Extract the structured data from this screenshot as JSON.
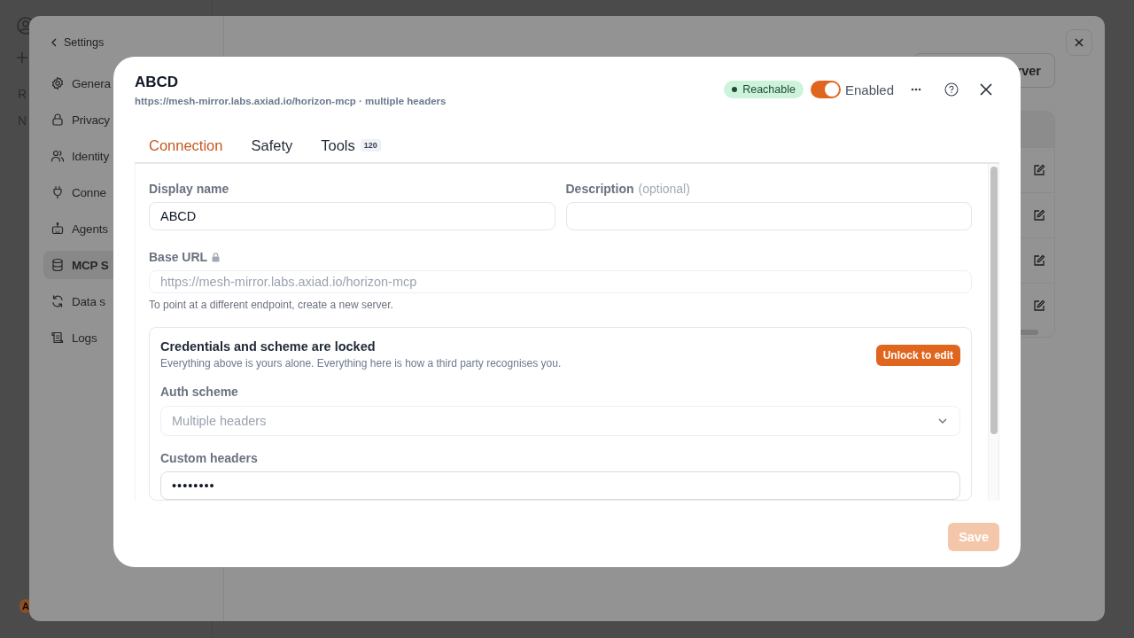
{
  "app": {
    "rail_items": [
      {
        "label": "R"
      },
      {
        "label": "N"
      }
    ],
    "avatar": "A"
  },
  "settings": {
    "back": "Settings",
    "nav": [
      {
        "label": "Genera",
        "selected": false
      },
      {
        "label": "Privacy",
        "selected": false
      },
      {
        "label": "Identity",
        "selected": false
      },
      {
        "label": "Conne",
        "selected": false
      },
      {
        "label": "Agents",
        "selected": false
      },
      {
        "label": "MCP S",
        "selected": true
      },
      {
        "label": "Data s",
        "selected": false
      },
      {
        "label": "Logs",
        "selected": false
      }
    ],
    "add_button": "rver",
    "rows": [
      {
        "kind": "editable"
      },
      {
        "kind": "editable"
      },
      {
        "kind": "editable"
      },
      {
        "kind": "editable"
      }
    ]
  },
  "dialog": {
    "title": "ABCD",
    "subtitle": "https://mesh-mirror.labs.axiad.io/horizon-mcp · multiple headers",
    "status": {
      "label": "Reachable"
    },
    "enabled": {
      "label": "Enabled",
      "on": true
    },
    "tabs": [
      {
        "label": "Connection",
        "selected": true
      },
      {
        "label": "Safety",
        "selected": false
      },
      {
        "label": "Tools",
        "badge": "120",
        "selected": false
      }
    ],
    "display_name": {
      "label": "Display name",
      "value": "ABCD"
    },
    "description": {
      "label": "Description",
      "optional": "(optional)"
    },
    "base_url": {
      "label": "Base URL",
      "value": "https://mesh-mirror.labs.axiad.io/horizon-mcp",
      "locked": true,
      "hint": "To point at a different endpoint, create a new server."
    },
    "credentials": {
      "title": "Credentials and scheme are locked",
      "text": "Everything above is yours alone. Everything here is how a third party recognises you.",
      "unlock_button": "Unlock to edit",
      "locked": true,
      "auth_scheme": {
        "label": "Auth scheme",
        "value": "Multiple headers"
      },
      "custom_headers": {
        "label": "Custom headers",
        "value": "••••••••"
      }
    },
    "save": {
      "label": "Save",
      "disabled": true
    }
  }
}
